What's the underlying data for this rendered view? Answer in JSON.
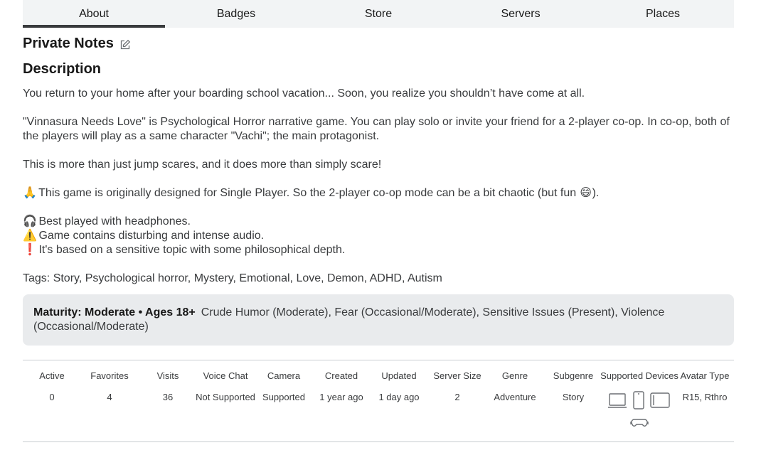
{
  "tabs": [
    {
      "label": "About",
      "active": true
    },
    {
      "label": "Badges",
      "active": false
    },
    {
      "label": "Store",
      "active": false
    },
    {
      "label": "Servers",
      "active": false
    },
    {
      "label": "Places",
      "active": false
    }
  ],
  "notes": {
    "title": "Private Notes",
    "edit_icon": "edit-icon"
  },
  "description": {
    "title": "Description",
    "para1": "You return to your home after your boarding school vacation... Soon, you realize you shouldn’t have come at all.",
    "para2": "\"Vinnasura Needs Love\" is Psychological Horror narrative game. You can play solo or invite your friend for a 2-player co-op. In co-op, both of the players will play as a same character \"Vachi\"; the main protagonist.",
    "para3": "This is more than just jump scares, and it does more than simply scare!",
    "para4_emoji": "🙏",
    "para4": "This game is originally designed for Single Player. So the 2-player co-op mode can be a bit chaotic (but fun ",
    "para4_emoji_end": "😄",
    "para4_end": ").",
    "line5_emoji": "🎧",
    "line5": "Best played with headphones.",
    "line6_emoji": "⚠️",
    "line6": "Game contains disturbing and intense audio.",
    "line7_emoji": "❗",
    "line7": "It's based on a sensitive topic with some philosophical depth.",
    "tags": "Tags: Story, Psychological horror, Mystery, Emotional, Love, Demon, ADHD, Autism"
  },
  "maturity": {
    "label": "Maturity: Moderate • Ages 18+",
    "details": "Crude Humor (Moderate), Fear (Occasional/Moderate), Sensitive Issues (Present), Violence (Occasional/Moderate)"
  },
  "stats": [
    {
      "label": "Active",
      "value": "0"
    },
    {
      "label": "Favorites",
      "value": "4"
    },
    {
      "label": "Visits",
      "value": "36"
    },
    {
      "label": "Voice Chat",
      "value": "Not Supported"
    },
    {
      "label": "Camera",
      "value": "Supported"
    },
    {
      "label": "Created",
      "value": "1 year ago"
    },
    {
      "label": "Updated",
      "value": "1 day ago"
    },
    {
      "label": "Server Size",
      "value": "2"
    },
    {
      "label": "Genre",
      "value": "Adventure"
    },
    {
      "label": "Subgenre",
      "value": "Story"
    },
    {
      "label": "Supported Devices",
      "value": ""
    },
    {
      "label": "Avatar Type",
      "value": "R15, Rthro"
    }
  ],
  "devices": [
    "computer-icon",
    "phone-icon",
    "tablet-icon",
    "console-icon"
  ]
}
